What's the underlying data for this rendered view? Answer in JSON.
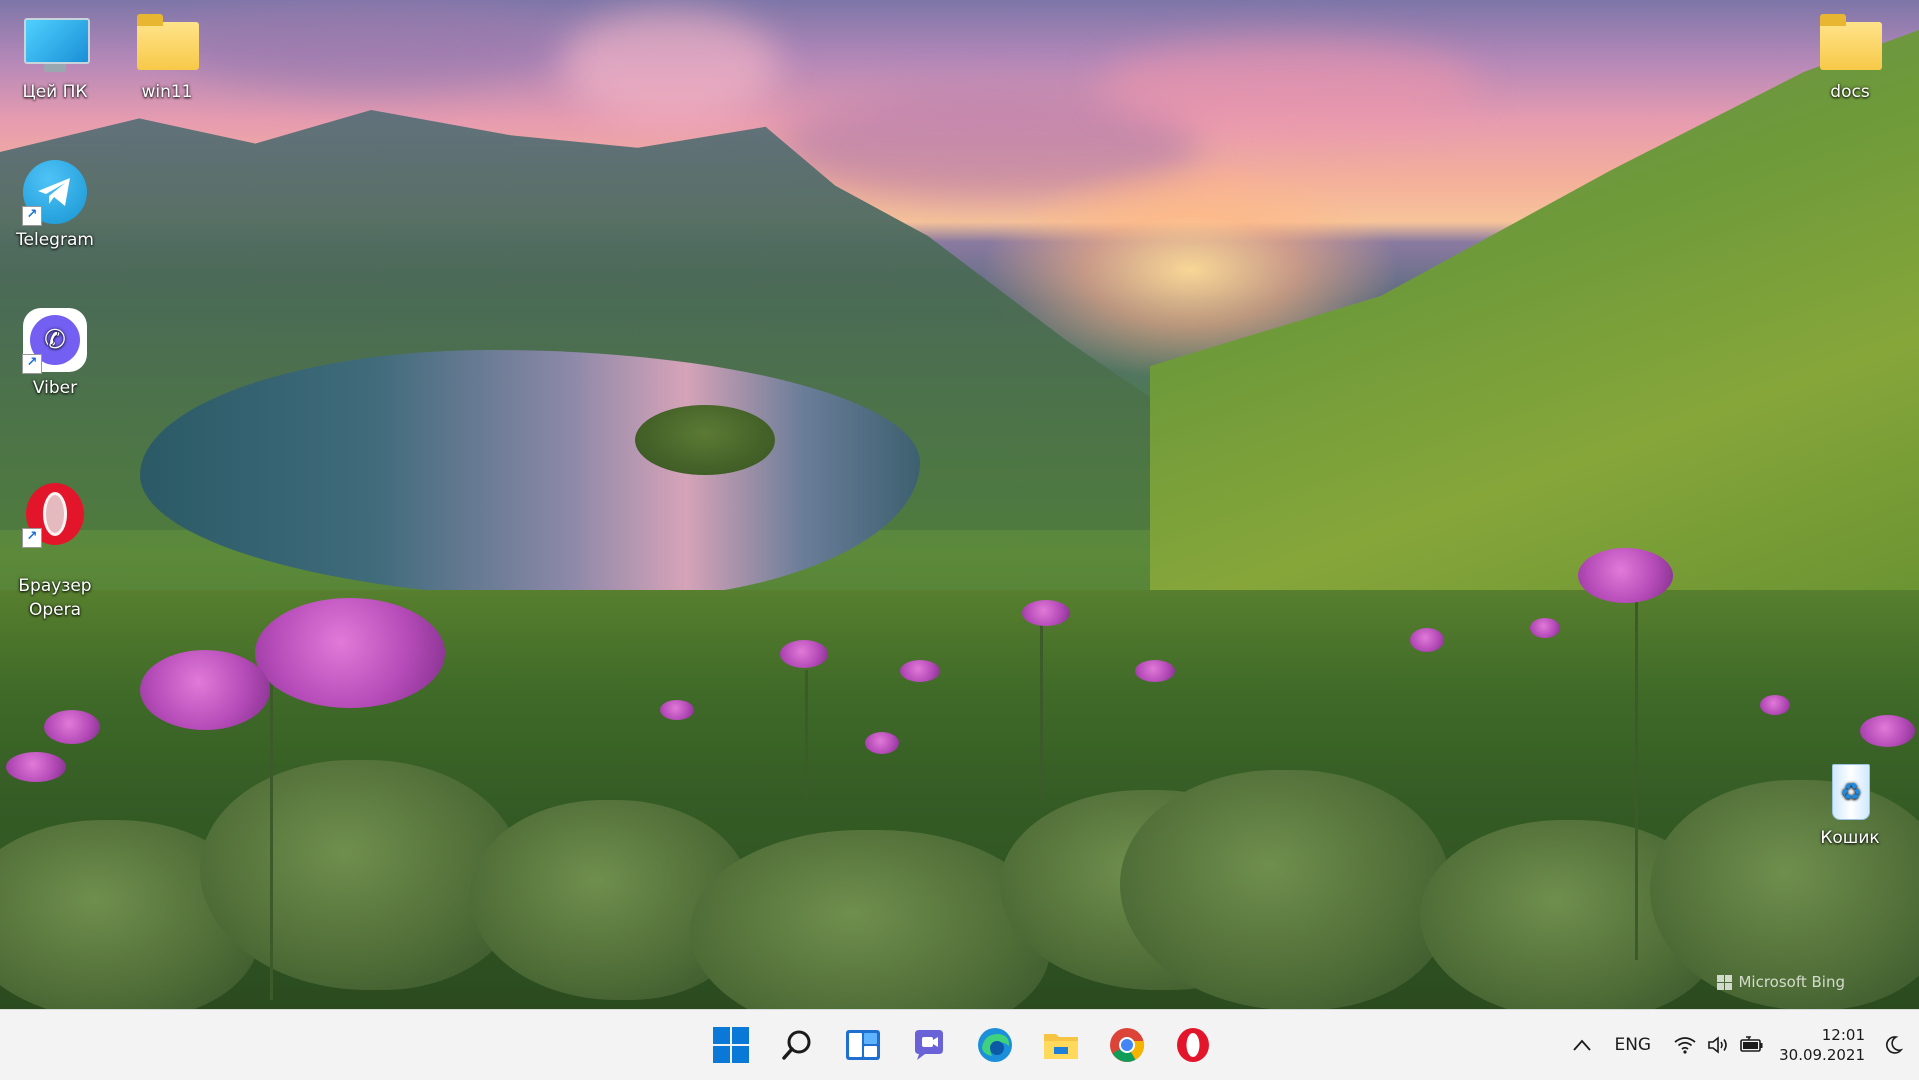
{
  "desktop": {
    "icons": [
      {
        "label": "Цей ПК",
        "icon": "computer-icon"
      },
      {
        "label": "win11",
        "icon": "folder-icon"
      },
      {
        "label": "Telegram",
        "icon": "telegram-icon"
      },
      {
        "label": "Viber",
        "icon": "viber-icon"
      },
      {
        "label": "Браузер\nOpera",
        "icon": "opera-icon"
      },
      {
        "label": "docs",
        "icon": "folder-icon"
      },
      {
        "label": "Кошик",
        "icon": "recycle-bin-icon"
      }
    ],
    "watermark": "Microsoft Bing"
  },
  "taskbar": {
    "apps": [
      {
        "name": "Start",
        "icon": "windows-start-icon"
      },
      {
        "name": "Search",
        "icon": "search-icon"
      },
      {
        "name": "Widgets",
        "icon": "widgets-icon"
      },
      {
        "name": "Chat",
        "icon": "teams-chat-icon"
      },
      {
        "name": "Microsoft Edge",
        "icon": "edge-icon"
      },
      {
        "name": "File Explorer",
        "icon": "file-explorer-icon"
      },
      {
        "name": "Google Chrome",
        "icon": "chrome-icon"
      },
      {
        "name": "Opera",
        "icon": "opera-icon"
      }
    ],
    "tray": {
      "language": "ENG",
      "time": "12:01",
      "date": "30.09.2021"
    }
  },
  "colors": {
    "taskbar_bg": "#f3f3f3",
    "accent": "#0a78d7"
  }
}
